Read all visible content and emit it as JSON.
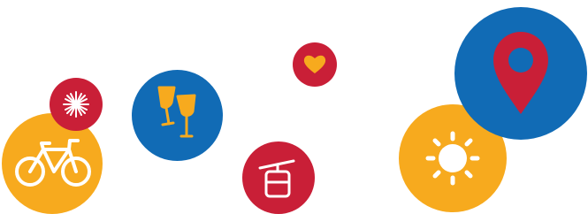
{
  "palette": {
    "yellow": "#F7AA1E",
    "red": "#C91F37",
    "blue": "#116BB5",
    "white": "#FFFFFF"
  },
  "bubbles": [
    {
      "name": "bike-bubble",
      "color": "red",
      "icon": "bicycle-icon"
    },
    {
      "name": "sparkle-bubble",
      "color": "red",
      "icon": "sparkle-icon"
    },
    {
      "name": "wine-bubble",
      "color": "blue",
      "icon": "wine-glasses-icon"
    },
    {
      "name": "cable-car-bubble",
      "color": "red",
      "icon": "cable-car-icon"
    },
    {
      "name": "heart-bubble",
      "color": "red",
      "icon": "heart-icon"
    },
    {
      "name": "sun-bubble",
      "color": "yellow",
      "icon": "sun-icon"
    },
    {
      "name": "location-bubble",
      "color": "blue",
      "icon": "location-pin-icon"
    }
  ]
}
